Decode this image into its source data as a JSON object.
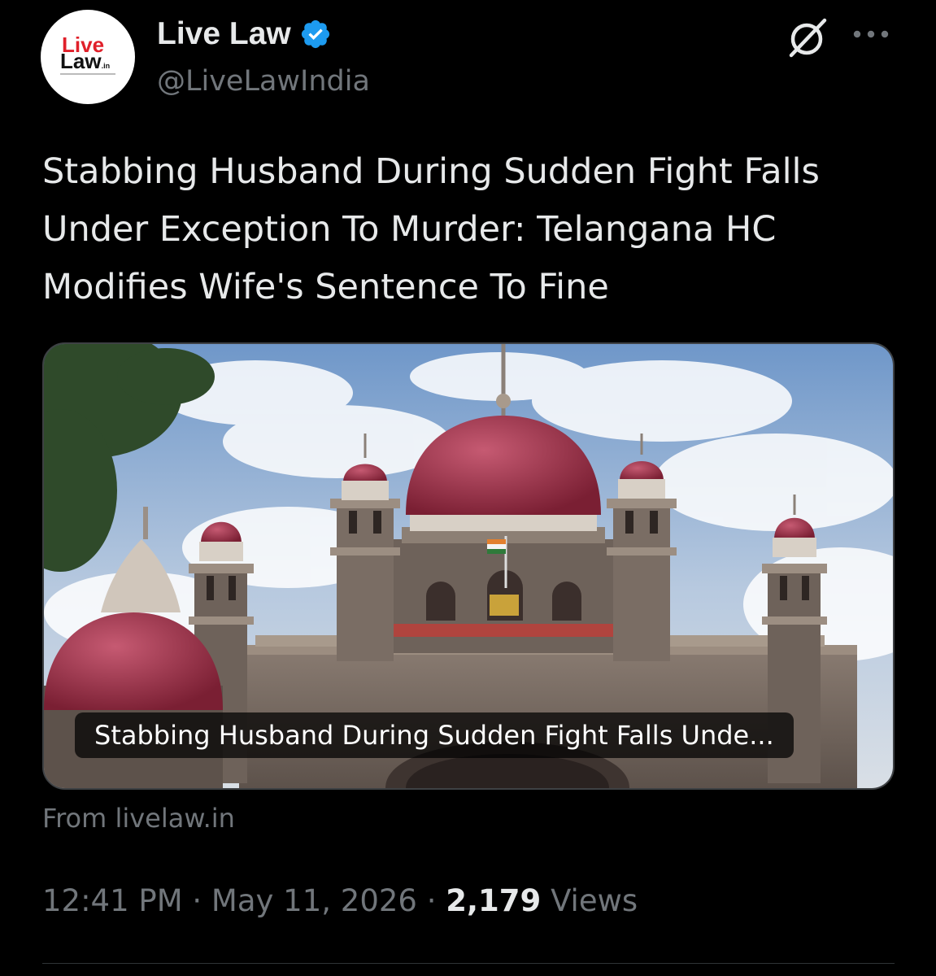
{
  "author": {
    "display_name": "Live Law",
    "handle": "@LiveLawIndia",
    "avatar_logo_line1": "Live",
    "avatar_logo_line2": "Law",
    "avatar_logo_suffix": ".in",
    "verified": true,
    "verified_color": "#1d9bf0"
  },
  "tweet": {
    "text": "Stabbing Husband During Sudden Fight Falls Under Exception To Murder: Telangana HC Modifies Wife's Sentence To Fine"
  },
  "link_card": {
    "title": "Stabbing Husband During Sudden Fight Falls Unde...",
    "source": "From livelaw.in",
    "image_description_icon": "high-court-building-image"
  },
  "meta": {
    "time": "12:41 PM",
    "separator": "·",
    "date": "May 11, 2026",
    "views_count": "2,179",
    "views_label": "Views"
  },
  "icons": {
    "grok": "grok-icon",
    "more": "more-icon",
    "verified": "verified-badge-icon"
  },
  "colors": {
    "background": "#000000",
    "text_primary": "#e7e9ea",
    "text_secondary": "#71767b",
    "brand_red": "#e0202a"
  }
}
